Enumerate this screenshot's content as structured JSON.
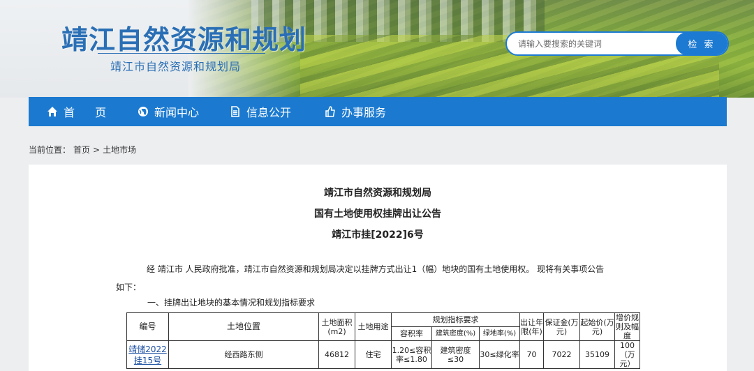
{
  "header": {
    "site_title": "靖江自然资源和规划",
    "site_subtitle": "靖江市自然资源和规划局",
    "search_placeholder": "请输入要搜索的关键词",
    "search_button": "检 索"
  },
  "nav": {
    "items": [
      {
        "label": "首 页",
        "icon": "home-icon"
      },
      {
        "label": "新闻中心",
        "icon": "globe-icon"
      },
      {
        "label": "信息公开",
        "icon": "document-icon"
      },
      {
        "label": "办事服务",
        "icon": "thumbs-up-icon"
      }
    ]
  },
  "breadcrumb": {
    "prefix": "当前位置：",
    "home": "首页",
    "sep": ">",
    "current": "土地市场"
  },
  "document": {
    "org": "靖江市自然资源和规划局",
    "title": "国有土地使用权挂牌出让公告",
    "number": "靖江市挂[2022]6号",
    "paragraph_line1": "经 靖江市 人民政府批准，靖江市自然资源和规划局决定以挂牌方式出让1（幅）地块的国有土地使用权。 现将有关事项公告",
    "paragraph_line2": "如下：",
    "section_title": "一、挂牌出让地块的基本情况和规划指标要求"
  },
  "table": {
    "headers": {
      "id": "编号",
      "location": "土地位置",
      "area": "土地面积(m2)",
      "use": "土地用途",
      "planning": "规划指标要求",
      "far": "容积率",
      "density": "建筑密度(%)",
      "green": "绿地率(%)",
      "term": "出让年限(年)",
      "deposit": "保证金(万元)",
      "start_price": "起始价(万元)",
      "increment": "增价规则及幅度"
    },
    "rows": [
      {
        "id": "靖储2022挂15号",
        "location": "经西路东侧",
        "area": "46812",
        "use": "住宅",
        "far": "1.20≤容积率≤1.80",
        "density": "建筑密度≤30",
        "green": "30≤绿化率",
        "term": "70",
        "deposit": "7022",
        "start_price": "35109",
        "increment": "100（万元）"
      }
    ]
  }
}
